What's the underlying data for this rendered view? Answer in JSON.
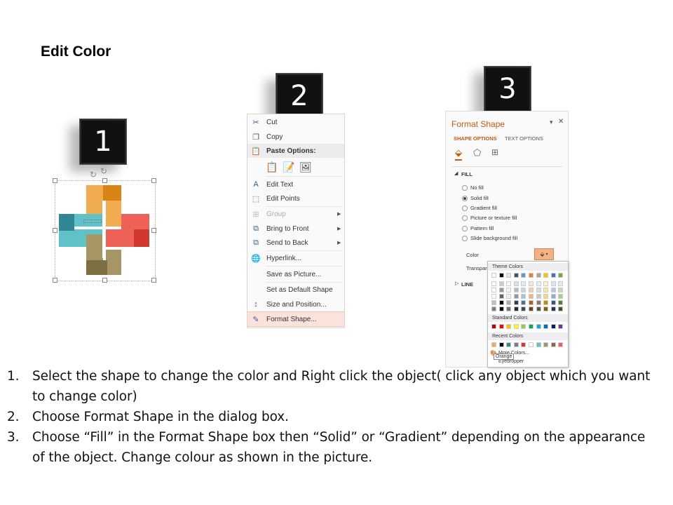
{
  "page": {
    "title": "Edit Color"
  },
  "steps": [
    {
      "number": "1"
    },
    {
      "number": "2"
    },
    {
      "number": "3"
    }
  ],
  "shape": {
    "colors": {
      "orange": "#f0ac4f",
      "dark_orange": "#d98312",
      "teal": "#5ec2c8",
      "dark_teal": "#2f8793",
      "red": "#ee6157",
      "dark_red": "#d2382d",
      "olive": "#a69665",
      "dark_olive": "#7e6f42"
    }
  },
  "context_menu": {
    "items": [
      {
        "label": "Cut",
        "icon": "scissors-icon"
      },
      {
        "label": "Copy",
        "icon": "copy-icon"
      },
      {
        "label": "Paste Options:",
        "icon": "paste-icon"
      },
      {
        "label": "Edit Text",
        "icon": "edit-text-icon"
      },
      {
        "label": "Edit Points",
        "icon": "edit-points-icon"
      },
      {
        "label": "Group",
        "icon": "group-icon"
      },
      {
        "label": "Bring to Front",
        "icon": "bring-front-icon"
      },
      {
        "label": "Send to Back",
        "icon": "send-back-icon"
      },
      {
        "label": "Hyperlink...",
        "icon": "hyperlink-icon"
      },
      {
        "label": "Save as Picture...",
        "icon": ""
      },
      {
        "label": "Set as Default Shape",
        "icon": ""
      },
      {
        "label": "Size and Position...",
        "icon": "size-position-icon"
      },
      {
        "label": "Format Shape...",
        "icon": "format-shape-icon"
      }
    ]
  },
  "format_pane": {
    "title": "Format Shape",
    "tabs": [
      "SHAPE OPTIONS",
      "TEXT OPTIONS"
    ],
    "section_fill": "FILL",
    "fill_options": [
      "No fill",
      "Solid fill",
      "Gradient fill",
      "Picture or texture fill",
      "Pattern fill",
      "Slide background fill"
    ],
    "selected_fill": "Solid fill",
    "color_label": "Color",
    "transparency_label": "Transpare",
    "section_line": "LINE",
    "accent_color": "#c55a11"
  },
  "color_picker": {
    "theme_label": "Theme Colors",
    "standard_label": "Standard Colors",
    "recent_label": "Recent Colors",
    "more_colors": "More Colors...",
    "eyedropper": "Eyedropper",
    "tooltip": "Orange",
    "theme_top": [
      "#ffffff",
      "#000000",
      "#e7e6e6",
      "#44546a",
      "#5b9bd5",
      "#ed7d31",
      "#a5a5a5",
      "#ffc000",
      "#4472c4",
      "#70ad47"
    ],
    "standard": [
      "#c00000",
      "#ff0000",
      "#ffc000",
      "#ffff00",
      "#92d050",
      "#00b050",
      "#00b0f0",
      "#0070c0",
      "#002060",
      "#7030a0"
    ],
    "recent": [
      "#f0ac4f",
      "#000000",
      "#2f8793",
      "#7e7e7e",
      "#d2382d",
      "#ffffff",
      "#5ec2c8",
      "#a69665",
      "#7e6f42",
      "#ee6157"
    ]
  },
  "instructions": [
    {
      "num": "1.",
      "text": "Select the shape to change the color and Right click the object( click any object which you want to change color)"
    },
    {
      "num": "2.",
      "text": "Choose Format Shape in the dialog box."
    },
    {
      "num": "3.",
      "text": "Choose “Fill” in the Format Shape box then “Solid” or “Gradient” depending on the appearance of the object. Change colour as shown in the picture."
    }
  ]
}
